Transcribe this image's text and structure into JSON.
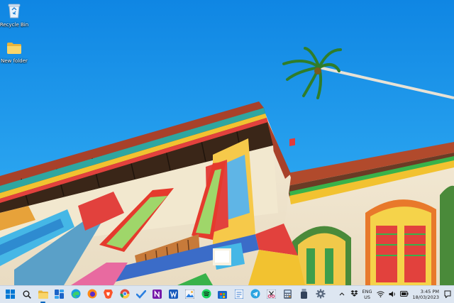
{
  "desktop": {
    "icons": [
      {
        "label": "Recycle Bin",
        "icon": "recycle-bin-icon"
      },
      {
        "label": "New folder",
        "icon": "folder-icon"
      }
    ]
  },
  "taskbar": {
    "apps": [
      {
        "name": "start",
        "icon": "windows-logo-icon"
      },
      {
        "name": "search",
        "icon": "search-icon"
      },
      {
        "name": "file-explorer",
        "icon": "folder-icon"
      },
      {
        "name": "widgets",
        "icon": "widgets-icon"
      },
      {
        "name": "edge",
        "icon": "edge-icon"
      },
      {
        "name": "firefox",
        "icon": "firefox-icon"
      },
      {
        "name": "brave",
        "icon": "brave-icon"
      },
      {
        "name": "chrome",
        "icon": "chrome-icon"
      },
      {
        "name": "todo",
        "icon": "checkmark-icon"
      },
      {
        "name": "onenote",
        "icon": "onenote-icon"
      },
      {
        "name": "word",
        "icon": "word-icon"
      },
      {
        "name": "photos",
        "icon": "photos-icon"
      },
      {
        "name": "spotify",
        "icon": "spotify-icon"
      },
      {
        "name": "microsoft-store",
        "icon": "store-icon"
      },
      {
        "name": "notepad",
        "icon": "notepad-icon"
      },
      {
        "name": "telegram",
        "icon": "telegram-icon"
      },
      {
        "name": "snipping",
        "icon": "scissors-icon"
      },
      {
        "name": "calculator",
        "icon": "calculator-icon"
      },
      {
        "name": "usb",
        "icon": "usb-icon"
      },
      {
        "name": "settings",
        "icon": "gear-icon"
      }
    ],
    "tray": {
      "lang_top": "ENG",
      "lang_bottom": "US",
      "time": "3:45 PM",
      "date": "18/03/2023"
    }
  },
  "colors": {
    "sky": "#1d8fe6",
    "taskbar": "#dde6f1",
    "accent": "#0067c0"
  }
}
